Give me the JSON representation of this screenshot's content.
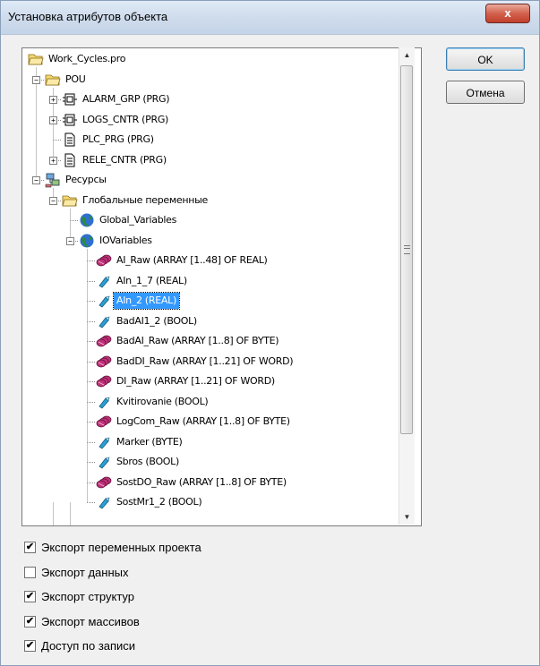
{
  "window": {
    "title": "Установка атрибутов объекта"
  },
  "buttons": {
    "ok": "OK",
    "cancel": "Отмена",
    "close": "x"
  },
  "tree": {
    "nodes": [
      {
        "label": "Work_Cycles.pro",
        "icon": "folder-open-icon"
      },
      {
        "label": "POU",
        "icon": "folder-open-icon",
        "expander": "minus"
      },
      {
        "label": "ALARM_GRP (PRG)",
        "icon": "function-block-icon",
        "expander": "plus"
      },
      {
        "label": "LOGS_CNTR (PRG)",
        "icon": "function-block-icon",
        "expander": "plus"
      },
      {
        "label": "PLC_PRG (PRG)",
        "icon": "program-document-icon"
      },
      {
        "label": "RELE_CNTR (PRG)",
        "icon": "program-document-icon",
        "expander": "plus"
      },
      {
        "label": "Ресурсы",
        "icon": "resources-network-icon",
        "expander": "minus"
      },
      {
        "label": "Глобальные переменные",
        "icon": "folder-open-icon",
        "expander": "minus"
      },
      {
        "label": "Global_Variables",
        "icon": "globe-icon"
      },
      {
        "label": "IOVariables",
        "icon": "globe-icon",
        "expander": "minus"
      },
      {
        "label": "AI_Raw (ARRAY [1..48] OF REAL)",
        "icon": "array-variable-icon"
      },
      {
        "label": "AIn_1_7 (REAL)",
        "icon": "variable-diamond-icon"
      },
      {
        "label": "AIn_2 (REAL)",
        "icon": "variable-diamond-icon",
        "selected": true
      },
      {
        "label": "BadAI1_2 (BOOL)",
        "icon": "variable-diamond-icon"
      },
      {
        "label": "BadAI_Raw (ARRAY [1..8] OF BYTE)",
        "icon": "array-variable-icon"
      },
      {
        "label": "BadDI_Raw (ARRAY [1..21] OF WORD)",
        "icon": "array-variable-icon"
      },
      {
        "label": "DI_Raw (ARRAY [1..21] OF WORD)",
        "icon": "array-variable-icon"
      },
      {
        "label": "Kvitirovanie (BOOL)",
        "icon": "variable-diamond-icon"
      },
      {
        "label": "LogCom_Raw (ARRAY [1..8] OF BYTE)",
        "icon": "array-variable-icon"
      },
      {
        "label": "Marker (BYTE)",
        "icon": "variable-diamond-icon"
      },
      {
        "label": "Sbros (BOOL)",
        "icon": "variable-diamond-icon"
      },
      {
        "label": "SostDO_Raw (ARRAY [1..8] OF BYTE)",
        "icon": "array-variable-icon"
      },
      {
        "label": "SostMr1_2 (BOOL)",
        "icon": "variable-diamond-icon"
      }
    ]
  },
  "checkboxes": [
    {
      "label": "Экспорт переменных проекта",
      "checked": true
    },
    {
      "label": "Экспорт данных",
      "checked": false
    },
    {
      "label": "Экспорт структур",
      "checked": true
    },
    {
      "label": "Экспорт массивов",
      "checked": true
    },
    {
      "label": "Доступ по записи",
      "checked": true
    }
  ],
  "colors": {
    "selection": "#3399ff",
    "folder": "#f5d76e",
    "globe": "#2e8b3a",
    "array": "#c0307a",
    "variable": "#2a9fd6"
  }
}
